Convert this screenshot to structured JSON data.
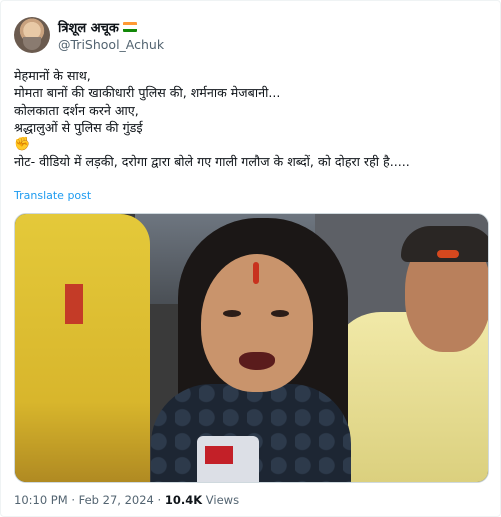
{
  "author": {
    "display_name": "त्रिशूल अचूक",
    "handle": "@TriShool_Achuk",
    "flag_icon": "india-flag-icon",
    "flag_colors": [
      "#ff9933",
      "#ffffff",
      "#138808"
    ]
  },
  "tweet": {
    "lines": [
      "मेहमानों के साथ,",
      "मोमता बानों की खाकीधारी पुलिस की, शर्मनाक मेजबानी...",
      "कोलकाता दर्शन करने आए,",
      "श्रद्धालुओं से पुलिस की गुंडई",
      "नोट- वीडियो में लड़की, दरोगा द्वारा बोले गए गाली गलौज के शब्दों, को दोहरा रही है....."
    ],
    "emoji_icon": "angry-fist-emoji",
    "translate_label": "Translate post"
  },
  "media": {
    "description_icon": "video-thumbnail"
  },
  "footer": {
    "time": "10:10 PM",
    "separator": "·",
    "date": "Feb 27, 2024",
    "views_count": "10.4K",
    "views_label": "Views"
  },
  "colors": {
    "link": "#1d9bf0",
    "secondary_text": "#536471",
    "border": "#cfd9de"
  }
}
